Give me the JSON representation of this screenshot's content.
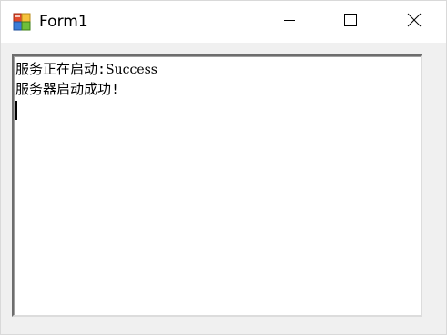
{
  "window": {
    "title": "Form1",
    "icon": "windows-forms-app-icon",
    "controls": {
      "minimize": "minimize-icon",
      "maximize": "maximize-icon",
      "close": "close-icon"
    }
  },
  "textbox": {
    "line1_prefix": "服务正在启动:",
    "line1_status": "Success",
    "line2": "服务器启动成功!"
  },
  "colors": {
    "titlebar": "#ffffff",
    "client": "#f0f0f0",
    "textbox_bg": "#ffffff"
  }
}
